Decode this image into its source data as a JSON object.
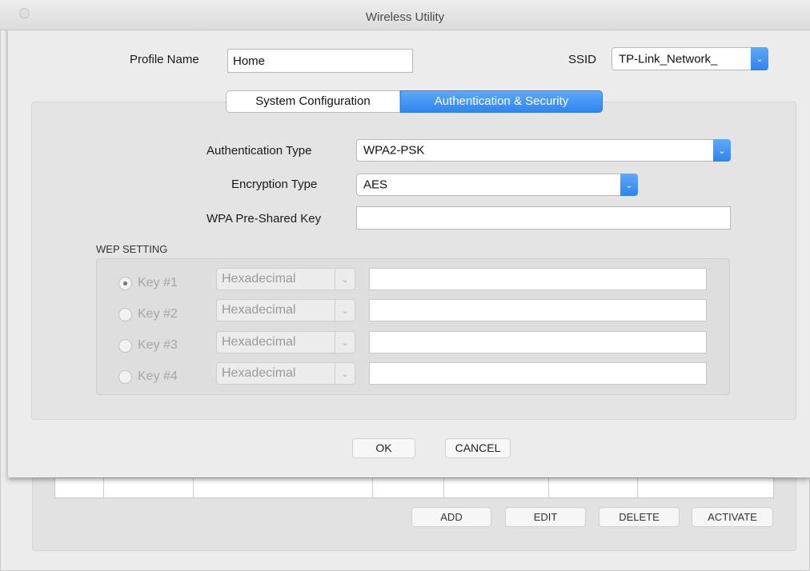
{
  "window_title": "Wireless Utility",
  "profile": {
    "label": "Profile Name",
    "value": "Home"
  },
  "ssid": {
    "label": "SSID",
    "value": "TP-Link_Network_"
  },
  "tabs": [
    {
      "label": "System Configuration",
      "active": false
    },
    {
      "label": "Authentication & Security",
      "active": true
    }
  ],
  "auth": {
    "auth_type_label": "Authentication Type",
    "auth_type_value": "WPA2-PSK",
    "encryption_label": "Encryption Type",
    "encryption_value": "AES",
    "psk_label": "WPA Pre-Shared Key",
    "psk_value": ""
  },
  "wep": {
    "heading": "WEP SETTING",
    "keys": [
      {
        "label": "Key #1",
        "format": "Hexadecimal",
        "selected": true
      },
      {
        "label": "Key #2",
        "format": "Hexadecimal",
        "selected": false
      },
      {
        "label": "Key #3",
        "format": "Hexadecimal",
        "selected": false
      },
      {
        "label": "Key #4",
        "format": "Hexadecimal",
        "selected": false
      }
    ]
  },
  "dialog_buttons": {
    "ok": "OK",
    "cancel": "CANCEL"
  },
  "main_buttons": {
    "add": "ADD",
    "edit": "EDIT",
    "delete": "DELETE",
    "activate": "ACTIVATE"
  },
  "colors": {
    "accent": "#2f86f0",
    "disabled_text": "#a6a6a6"
  }
}
